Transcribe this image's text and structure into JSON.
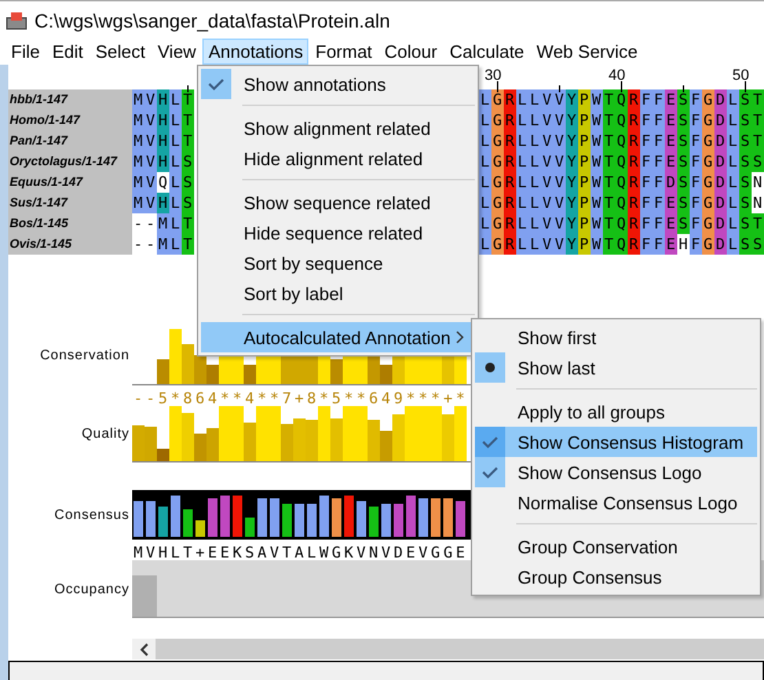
{
  "window": {
    "title": "C:\\wgs\\wgs\\sanger_data\\fasta\\Protein.aln"
  },
  "menu_bar": [
    {
      "label": "File",
      "selected": false
    },
    {
      "label": "Edit",
      "selected": false
    },
    {
      "label": "Select",
      "selected": false
    },
    {
      "label": "View",
      "selected": false
    },
    {
      "label": "Annotations",
      "selected": true
    },
    {
      "label": "Format",
      "selected": false
    },
    {
      "label": "Colour",
      "selected": false
    },
    {
      "label": "Calculate",
      "selected": false
    },
    {
      "label": "Web Service",
      "selected": false
    }
  ],
  "ruler": [
    "30",
    "40",
    "50"
  ],
  "sequences": [
    {
      "name": "hbb/1-147",
      "left": [
        {
          "text": "MVHLT",
          "shaded": true
        }
      ],
      "right": [
        {
          "text": "LGRLLVVYPWTQRFFESFGDLST",
          "shaded": true
        }
      ]
    },
    {
      "name": "Homo/1-147",
      "left": [
        {
          "text": "MVHLT",
          "shaded": true
        }
      ],
      "right": [
        {
          "text": "LGRLLVVYPWTQRFFESFGDLST",
          "shaded": true
        }
      ]
    },
    {
      "name": "Pan/1-147",
      "left": [
        {
          "text": "MVHLT",
          "shaded": true
        }
      ],
      "right": [
        {
          "text": "LGRLLVVYPWTQRFFESFGDLST",
          "shaded": true
        }
      ]
    },
    {
      "name": "Oryctolagus/1-147",
      "left": [
        {
          "text": "MVHLS",
          "shaded": true
        }
      ],
      "right": [
        {
          "text": "LGRLLVVYPWTQRFFESFGDLSS",
          "shaded": true
        }
      ]
    },
    {
      "name": "Equus/1-147",
      "left": [
        {
          "text": "MV",
          "shaded": true
        },
        {
          "text": "Q",
          "shaded": false
        },
        {
          "text": "LS",
          "shaded": true
        }
      ],
      "right": [
        {
          "text": "LGRLLVVYPWTQRFFDSFGDLS",
          "shaded": true
        },
        {
          "text": "N",
          "shaded": false
        }
      ]
    },
    {
      "name": "Sus/1-147",
      "left": [
        {
          "text": "MVHLS",
          "shaded": true
        }
      ],
      "right": [
        {
          "text": "LGRLLVVYPWTQRFFESFGDLS",
          "shaded": true
        },
        {
          "text": "N",
          "shaded": false
        }
      ]
    },
    {
      "name": "Bos/1-145",
      "left": [
        {
          "text": "--MLT",
          "shaded": true
        }
      ],
      "right": [
        {
          "text": "LGRLLVVYPWTQRFFESFGDLST",
          "shaded": true
        }
      ]
    },
    {
      "name": "Ovis/1-145",
      "left": [
        {
          "text": "--MLT",
          "shaded": true
        }
      ],
      "right": [
        {
          "text": "LGRLLVVYPWTQRFFE",
          "shaded": true
        },
        {
          "text": "H",
          "shaded": false
        },
        {
          "text": "FGDLSS",
          "shaded": true
        }
      ]
    }
  ],
  "annotations": [
    {
      "label": "Conservation",
      "kind": "conservation"
    },
    {
      "kind": "symbols",
      "text": "--5*864**4**7+8*5**649***+*"
    },
    {
      "label": "Quality",
      "kind": "quality"
    },
    {
      "label": "Consensus",
      "kind": "logo"
    },
    {
      "kind": "consensus",
      "text": "MVHLT+EEKSAVTALWGKVNVDEVGGE"
    },
    {
      "label": "Occupancy",
      "kind": "occupancy"
    }
  ],
  "annotations_menu": [
    {
      "kind": "check",
      "label": "Show annotations",
      "checked": true,
      "selected": false
    },
    {
      "kind": "separator"
    },
    {
      "kind": "item",
      "label": "Show alignment related",
      "selected": false
    },
    {
      "kind": "item",
      "label": "Hide alignment related",
      "selected": false
    },
    {
      "kind": "separator"
    },
    {
      "kind": "item",
      "label": "Show sequence related",
      "selected": false
    },
    {
      "kind": "item",
      "label": "Hide sequence related",
      "selected": false
    },
    {
      "kind": "item",
      "label": "Sort by sequence",
      "selected": false
    },
    {
      "kind": "item",
      "label": "Sort by label",
      "selected": false
    },
    {
      "kind": "separator"
    },
    {
      "kind": "submenu",
      "label": "Autocalculated Annotation",
      "selected": true
    }
  ],
  "autocalculated_submenu": [
    {
      "kind": "radio",
      "label": "Show first",
      "checked": false,
      "selected": false
    },
    {
      "kind": "radio",
      "label": "Show last",
      "checked": true,
      "selected": false
    },
    {
      "kind": "separator"
    },
    {
      "kind": "check",
      "label": "Apply to all groups",
      "checked": false,
      "selected": false
    },
    {
      "kind": "check",
      "label": "Show Consensus Histogram",
      "checked": true,
      "selected": true
    },
    {
      "kind": "check",
      "label": "Show Consensus Logo",
      "checked": true,
      "selected": false
    },
    {
      "kind": "check",
      "label": "Normalise Consensus Logo",
      "checked": false,
      "selected": false
    },
    {
      "kind": "separator"
    },
    {
      "kind": "item",
      "label": "Group Conservation",
      "selected": false
    },
    {
      "kind": "item",
      "label": "Group Consensus",
      "selected": false
    }
  ]
}
